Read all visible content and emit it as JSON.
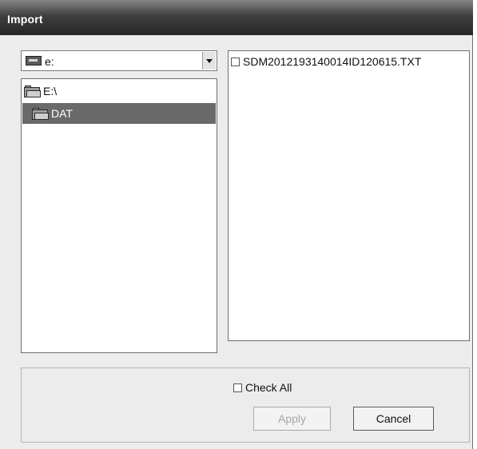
{
  "window": {
    "title": "Import"
  },
  "drive_select": {
    "value": "e:",
    "icon": "drive-icon"
  },
  "folder_tree": {
    "items": [
      {
        "label": "E:\\",
        "icon": "open-folder-icon",
        "selected": false
      },
      {
        "label": "DAT",
        "icon": "open-folder-icon",
        "selected": true
      }
    ]
  },
  "file_list": {
    "items": [
      {
        "label": "SDM2012193140014ID120615.TXT",
        "checked": false
      }
    ]
  },
  "footer": {
    "check_all_label": "Check All",
    "apply_label": "Apply",
    "cancel_label": "Cancel"
  }
}
